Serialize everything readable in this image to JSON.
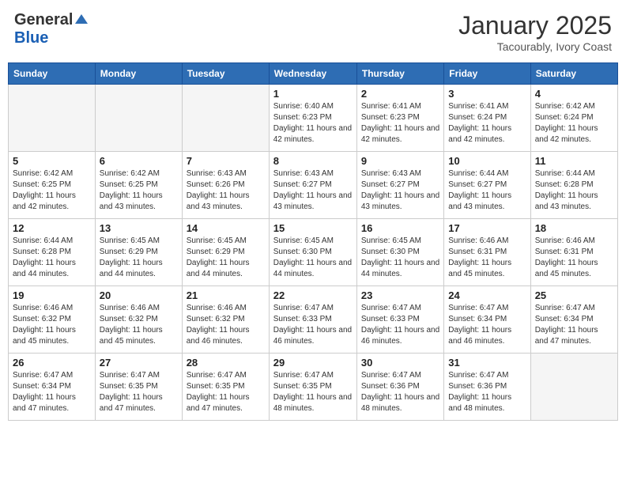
{
  "header": {
    "logo_general": "General",
    "logo_blue": "Blue",
    "month_title": "January 2025",
    "location": "Tacourably, Ivory Coast"
  },
  "days_of_week": [
    "Sunday",
    "Monday",
    "Tuesday",
    "Wednesday",
    "Thursday",
    "Friday",
    "Saturday"
  ],
  "weeks": [
    [
      {
        "day": "",
        "info": ""
      },
      {
        "day": "",
        "info": ""
      },
      {
        "day": "",
        "info": ""
      },
      {
        "day": "1",
        "info": "Sunrise: 6:40 AM\nSunset: 6:23 PM\nDaylight: 11 hours\nand 42 minutes."
      },
      {
        "day": "2",
        "info": "Sunrise: 6:41 AM\nSunset: 6:23 PM\nDaylight: 11 hours\nand 42 minutes."
      },
      {
        "day": "3",
        "info": "Sunrise: 6:41 AM\nSunset: 6:24 PM\nDaylight: 11 hours\nand 42 minutes."
      },
      {
        "day": "4",
        "info": "Sunrise: 6:42 AM\nSunset: 6:24 PM\nDaylight: 11 hours\nand 42 minutes."
      }
    ],
    [
      {
        "day": "5",
        "info": "Sunrise: 6:42 AM\nSunset: 6:25 PM\nDaylight: 11 hours\nand 42 minutes."
      },
      {
        "day": "6",
        "info": "Sunrise: 6:42 AM\nSunset: 6:25 PM\nDaylight: 11 hours\nand 43 minutes."
      },
      {
        "day": "7",
        "info": "Sunrise: 6:43 AM\nSunset: 6:26 PM\nDaylight: 11 hours\nand 43 minutes."
      },
      {
        "day": "8",
        "info": "Sunrise: 6:43 AM\nSunset: 6:27 PM\nDaylight: 11 hours\nand 43 minutes."
      },
      {
        "day": "9",
        "info": "Sunrise: 6:43 AM\nSunset: 6:27 PM\nDaylight: 11 hours\nand 43 minutes."
      },
      {
        "day": "10",
        "info": "Sunrise: 6:44 AM\nSunset: 6:27 PM\nDaylight: 11 hours\nand 43 minutes."
      },
      {
        "day": "11",
        "info": "Sunrise: 6:44 AM\nSunset: 6:28 PM\nDaylight: 11 hours\nand 43 minutes."
      }
    ],
    [
      {
        "day": "12",
        "info": "Sunrise: 6:44 AM\nSunset: 6:28 PM\nDaylight: 11 hours\nand 44 minutes."
      },
      {
        "day": "13",
        "info": "Sunrise: 6:45 AM\nSunset: 6:29 PM\nDaylight: 11 hours\nand 44 minutes."
      },
      {
        "day": "14",
        "info": "Sunrise: 6:45 AM\nSunset: 6:29 PM\nDaylight: 11 hours\nand 44 minutes."
      },
      {
        "day": "15",
        "info": "Sunrise: 6:45 AM\nSunset: 6:30 PM\nDaylight: 11 hours\nand 44 minutes."
      },
      {
        "day": "16",
        "info": "Sunrise: 6:45 AM\nSunset: 6:30 PM\nDaylight: 11 hours\nand 44 minutes."
      },
      {
        "day": "17",
        "info": "Sunrise: 6:46 AM\nSunset: 6:31 PM\nDaylight: 11 hours\nand 45 minutes."
      },
      {
        "day": "18",
        "info": "Sunrise: 6:46 AM\nSunset: 6:31 PM\nDaylight: 11 hours\nand 45 minutes."
      }
    ],
    [
      {
        "day": "19",
        "info": "Sunrise: 6:46 AM\nSunset: 6:32 PM\nDaylight: 11 hours\nand 45 minutes."
      },
      {
        "day": "20",
        "info": "Sunrise: 6:46 AM\nSunset: 6:32 PM\nDaylight: 11 hours\nand 45 minutes."
      },
      {
        "day": "21",
        "info": "Sunrise: 6:46 AM\nSunset: 6:32 PM\nDaylight: 11 hours\nand 46 minutes."
      },
      {
        "day": "22",
        "info": "Sunrise: 6:47 AM\nSunset: 6:33 PM\nDaylight: 11 hours\nand 46 minutes."
      },
      {
        "day": "23",
        "info": "Sunrise: 6:47 AM\nSunset: 6:33 PM\nDaylight: 11 hours\nand 46 minutes."
      },
      {
        "day": "24",
        "info": "Sunrise: 6:47 AM\nSunset: 6:34 PM\nDaylight: 11 hours\nand 46 minutes."
      },
      {
        "day": "25",
        "info": "Sunrise: 6:47 AM\nSunset: 6:34 PM\nDaylight: 11 hours\nand 47 minutes."
      }
    ],
    [
      {
        "day": "26",
        "info": "Sunrise: 6:47 AM\nSunset: 6:34 PM\nDaylight: 11 hours\nand 47 minutes."
      },
      {
        "day": "27",
        "info": "Sunrise: 6:47 AM\nSunset: 6:35 PM\nDaylight: 11 hours\nand 47 minutes."
      },
      {
        "day": "28",
        "info": "Sunrise: 6:47 AM\nSunset: 6:35 PM\nDaylight: 11 hours\nand 47 minutes."
      },
      {
        "day": "29",
        "info": "Sunrise: 6:47 AM\nSunset: 6:35 PM\nDaylight: 11 hours\nand 48 minutes."
      },
      {
        "day": "30",
        "info": "Sunrise: 6:47 AM\nSunset: 6:36 PM\nDaylight: 11 hours\nand 48 minutes."
      },
      {
        "day": "31",
        "info": "Sunrise: 6:47 AM\nSunset: 6:36 PM\nDaylight: 11 hours\nand 48 minutes."
      },
      {
        "day": "",
        "info": ""
      }
    ]
  ]
}
